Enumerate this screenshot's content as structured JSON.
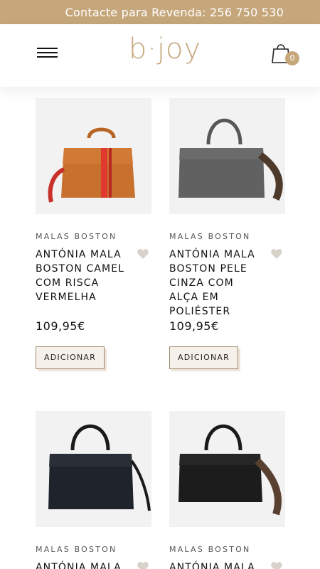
{
  "topbar": {
    "text": "Contacte para Revenda: 256 750 530"
  },
  "header": {
    "logo": "b·joy",
    "cart_count": "0"
  },
  "colors": {
    "accent": "#c6a77b",
    "photo_bg": "#f2f2f2"
  },
  "products": [
    {
      "category": "MALAS BOSTON",
      "title": "ANTÓNIA MALA BOSTON CAMEL COM RISCA VERMELHA",
      "price": "109,95€",
      "button": "ADICIONAR",
      "image": "camel-bag-with-red-stripe"
    },
    {
      "category": "MALAS BOSTON",
      "title": "ANTÓNIA MALA BOSTON PELE CINZA COM ALÇA EM POLIÉSTER",
      "price": "109,95€",
      "button": "ADICIONAR",
      "image": "grey-bag-with-woven-strap"
    },
    {
      "category": "MALAS BOSTON",
      "title": "ANTÓNIA MALA",
      "price": "",
      "button": "",
      "image": "black-bag"
    },
    {
      "category": "MALAS BOSTON",
      "title": "ANTÓNIA MALA",
      "price": "",
      "button": "",
      "image": "black-bag-with-woven-strap"
    }
  ]
}
